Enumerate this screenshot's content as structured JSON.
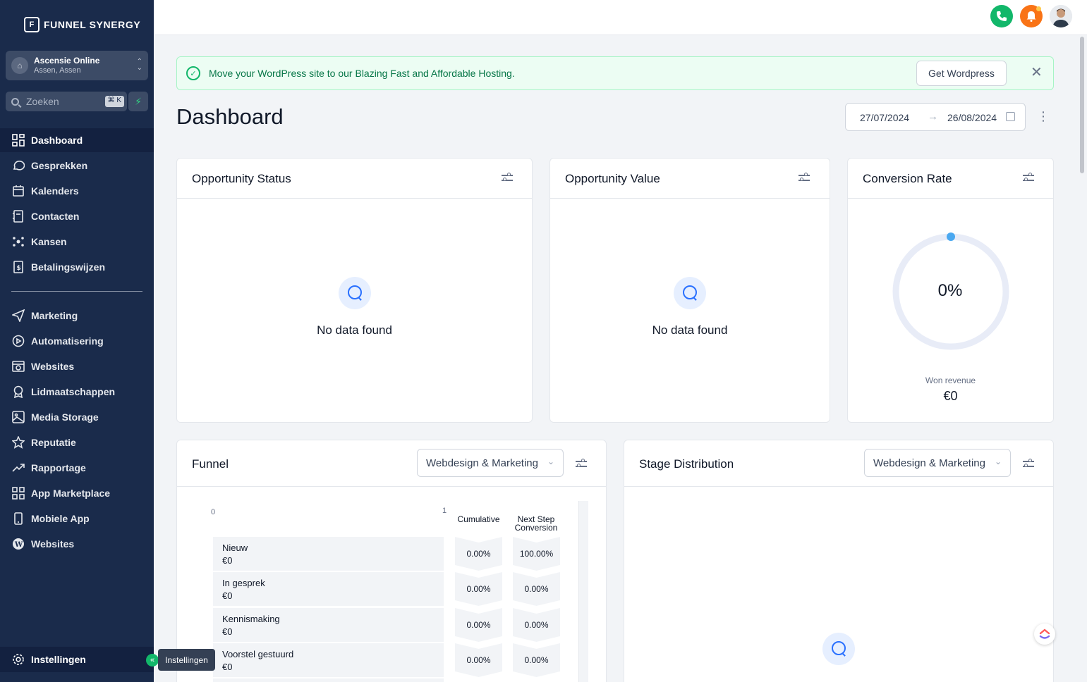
{
  "brand": {
    "name": "FUNNEL SYNERGY"
  },
  "account": {
    "name": "Ascensie Online",
    "location": "Assen, Assen"
  },
  "search": {
    "placeholder": "Zoeken",
    "shortcut": "⌘ K"
  },
  "nav": {
    "primary": [
      {
        "label": "Dashboard",
        "icon": "grid-icon",
        "active": true
      },
      {
        "label": "Gesprekken",
        "icon": "chat-icon"
      },
      {
        "label": "Kalenders",
        "icon": "calendar-icon"
      },
      {
        "label": "Contacten",
        "icon": "contacts-icon"
      },
      {
        "label": "Kansen",
        "icon": "network-icon"
      },
      {
        "label": "Betalingswijzen",
        "icon": "invoice-icon"
      }
    ],
    "secondary": [
      {
        "label": "Marketing",
        "icon": "send-icon"
      },
      {
        "label": "Automatisering",
        "icon": "automation-icon"
      },
      {
        "label": "Websites",
        "icon": "website-icon"
      },
      {
        "label": "Lidmaatschappen",
        "icon": "badge-icon"
      },
      {
        "label": "Media Storage",
        "icon": "image-icon"
      },
      {
        "label": "Reputatie",
        "icon": "star-icon"
      },
      {
        "label": "Rapportage",
        "icon": "trend-icon"
      },
      {
        "label": "App Marketplace",
        "icon": "apps-icon"
      },
      {
        "label": "Mobiele App",
        "icon": "phone-icon"
      },
      {
        "label": "Websites",
        "icon": "wordpress-icon"
      }
    ],
    "settings": "Instellingen",
    "tooltip": "Instellingen"
  },
  "banner": {
    "text": "Move your WordPress site to our Blazing Fast and Affordable Hosting.",
    "button": "Get Wordpress"
  },
  "page": {
    "title": "Dashboard"
  },
  "daterange": {
    "start": "27/07/2024",
    "end": "26/08/2024"
  },
  "cards": {
    "opportunity_status": {
      "title": "Opportunity Status",
      "empty": "No data found"
    },
    "opportunity_value": {
      "title": "Opportunity Value",
      "empty": "No data found"
    },
    "conversion_rate": {
      "title": "Conversion Rate",
      "value": "0%",
      "won_label": "Won revenue",
      "won_value": "€0"
    },
    "funnel": {
      "title": "Funnel",
      "pipeline": "Webdesign & Marketing",
      "axis_min": "0",
      "axis_max": "1",
      "col_cumulative": "Cumulative",
      "col_next": "Next Step Conversion",
      "stages": [
        {
          "name": "Nieuw",
          "value": "€0",
          "cumulative": "0.00%",
          "next": "100.00%"
        },
        {
          "name": "In gesprek",
          "value": "€0",
          "cumulative": "0.00%",
          "next": "0.00%"
        },
        {
          "name": "Kennismaking",
          "value": "€0",
          "cumulative": "0.00%",
          "next": "0.00%"
        },
        {
          "name": "Voorstel gestuurd",
          "value": "€0",
          "cumulative": "0.00%",
          "next": "0.00%"
        }
      ]
    },
    "stage_distribution": {
      "title": "Stage Distribution",
      "pipeline": "Webdesign & Marketing"
    }
  },
  "colors": {
    "sidebar": "#1a2b4b",
    "phone_button": "#12b76a",
    "notification_button": "#f97316",
    "accent_blue": "#2970ff",
    "banner_bg": "#ecfdf3"
  }
}
